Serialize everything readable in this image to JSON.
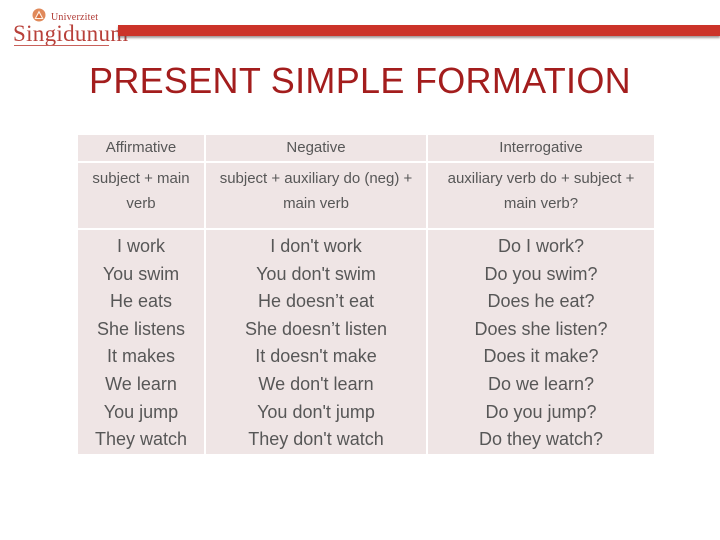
{
  "logo": {
    "small_text": "Univerzitet",
    "name": "Singidunum",
    "emblem_icon": "university-emblem-icon"
  },
  "colors": {
    "accent_red": "#cc3329",
    "title_red": "#a31d1d",
    "cell_background": "#efe5e5",
    "cell_text": "#575757"
  },
  "title": "PRESENT SIMPLE FORMATION",
  "table": {
    "headers": [
      "Affirmative",
      "Negative",
      "Interrogative"
    ],
    "rules": [
      "subject + main verb",
      "subject + auxiliary do (neg) + main verb",
      "auxiliary verb do + subject + main verb?"
    ],
    "rules_lines": [
      [
        "subject + main",
        "verb"
      ],
      [
        "subject + auxiliary do (neg) +",
        "main verb"
      ],
      [
        "auxiliary verb do + subject +",
        "main verb?"
      ]
    ],
    "examples": {
      "affirmative": [
        "I work",
        "You swim",
        "He eats",
        "She listens",
        "It makes",
        "We learn",
        "You jump",
        "They watch"
      ],
      "negative": [
        "I don't work",
        "You don't swim",
        "He doesn’t eat",
        "She doesn’t listen",
        "It doesn't make",
        "We don't learn",
        "You don't jump",
        "They don't watch"
      ],
      "interrogative": [
        "Do I work?",
        "Do you swim?",
        "Does he eat?",
        "Does she listen?",
        "Does it make?",
        "Do we learn?",
        "Do you jump?",
        "Do they watch?"
      ]
    }
  }
}
